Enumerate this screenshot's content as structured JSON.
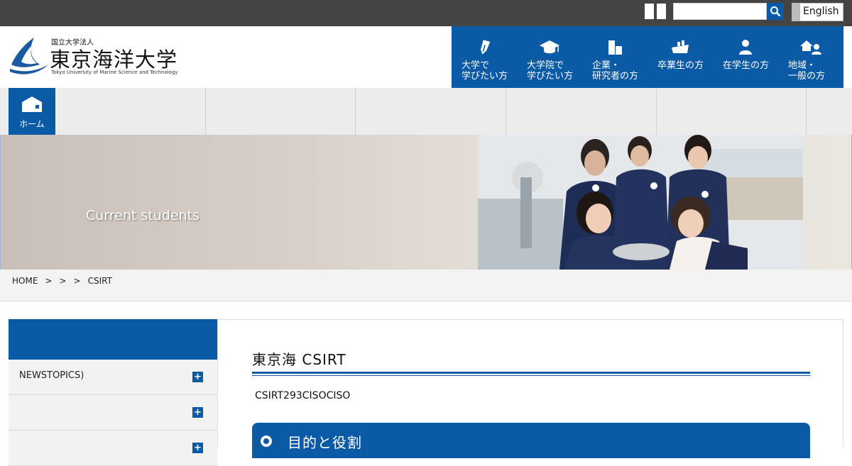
{
  "topbar": {
    "search_placeholder": "",
    "lang_label": "English"
  },
  "logo": {
    "sub": "国立大学法人",
    "main": "東京海洋大学",
    "en": "Tokyo University of Marine Science and Technology"
  },
  "gnav": {
    "items": [
      {
        "label": "大学で\n学びたい方",
        "icon": "pen-nib-icon"
      },
      {
        "label": "大学院で\n学びたい方",
        "icon": "graduation-cap-icon"
      },
      {
        "label": "企業・\n研究者の方",
        "icon": "building-icon"
      },
      {
        "label": "卒業生の方",
        "icon": "ship-icon"
      },
      {
        "label": "在学生の方",
        "icon": "person-icon"
      },
      {
        "label": "地域・\n一般の方",
        "icon": "home-person-icon"
      }
    ]
  },
  "subnav": {
    "home_label": "ホーム"
  },
  "hero": {
    "title": "Current students"
  },
  "breadcrumb": {
    "items": [
      "HOME",
      ">",
      ">",
      ">",
      "CSIRT"
    ]
  },
  "sidebar": {
    "items": [
      {
        "label": "NEWSTOPICS)"
      },
      {
        "label": ""
      },
      {
        "label": ""
      }
    ]
  },
  "content": {
    "title": "東京海 CSIRT",
    "text": "CSIRT293CISOCISO",
    "section_label": "目的と役割"
  },
  "colors": {
    "brand": "#0b5aa6",
    "topbar": "#444444"
  }
}
